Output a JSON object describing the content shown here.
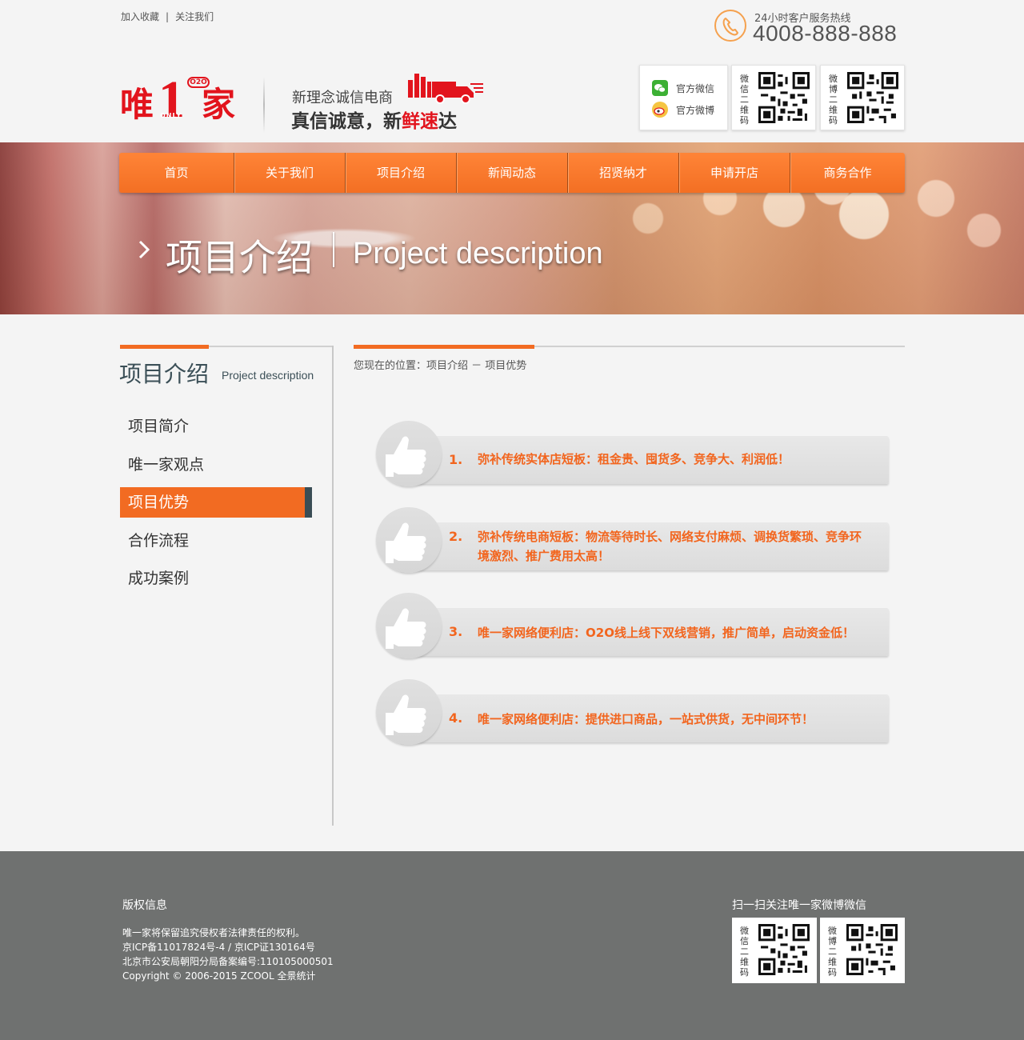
{
  "top_links": [
    "加入收藏",
    "关注我们"
  ],
  "top_links_separator": "|",
  "hotline": {
    "label": "24小时客户服务热线",
    "number": "4008-888-888"
  },
  "logo": {
    "text_left": "唯",
    "text_number": "1",
    "text_right": "家",
    "badge": "O2O",
    "sub": "ONLY"
  },
  "slogan": {
    "line1": "新理念诚信电商",
    "line2_prefix": "真信诚意，新",
    "line2_red1": "鲜",
    "line2_red2": "速",
    "line2_suffix": "达"
  },
  "social": {
    "wechat_label": "官方微信",
    "weibo_label": "官方微博"
  },
  "qr_codes": [
    {
      "label": "微信二维码",
      "icon": "qr-code-icon"
    },
    {
      "label": "微博二维码",
      "icon": "qr-code-icon"
    }
  ],
  "nav": [
    {
      "label": "首页"
    },
    {
      "label": "关于我们"
    },
    {
      "label": "项目介绍"
    },
    {
      "label": "新闻动态"
    },
    {
      "label": "招贤纳才"
    },
    {
      "label": "申请开店"
    },
    {
      "label": "商务合作"
    }
  ],
  "banner": {
    "title_cn": "项目介绍",
    "title_en": "Project description"
  },
  "sidebar": {
    "title_cn": "项目介绍",
    "title_en": "Project description",
    "items": [
      {
        "label": "项目简介",
        "active": false
      },
      {
        "label": "唯一家观点",
        "active": false
      },
      {
        "label": "项目优势",
        "active": true
      },
      {
        "label": "合作流程",
        "active": false
      },
      {
        "label": "成功案例",
        "active": false
      }
    ]
  },
  "breadcrumb": "您现在的位置：项目介绍 － 项目优势",
  "advantages": [
    {
      "num": "1.",
      "text": "弥补传统实体店短板：租金贵、囤货多、竞争大、利润低！"
    },
    {
      "num": "2.",
      "text": "弥补传统电商短板：物流等待时长、网络支付麻烦、调换货繁琐、竞争环境激烈、推广费用太高！"
    },
    {
      "num": "3.",
      "text": "唯一家网络便利店：O2O线上线下双线营销，推广简单，启动资金低！"
    },
    {
      "num": "4.",
      "text": "唯一家网络便利店：提供进口商品，一站式供货，无中间环节！"
    }
  ],
  "footer": {
    "copyright_title": "版权信息",
    "lines": [
      "唯一家将保留追究侵权者法律责任的权利。",
      "京ICP备11017824号-4 / 京ICP证130164号",
      "北京市公安局朝阳分局备案编号:110105000501",
      "Copyright © 2006-2015 ZCOOL 全景统计"
    ],
    "scan_title": "扫一扫关注唯一家微博微信"
  },
  "colors": {
    "accent": "#f26b22",
    "nav": "#f57a2e",
    "footer_bg": "#6f7170",
    "dark_slate": "#3a4d55",
    "logo_red": "#e2141d"
  }
}
